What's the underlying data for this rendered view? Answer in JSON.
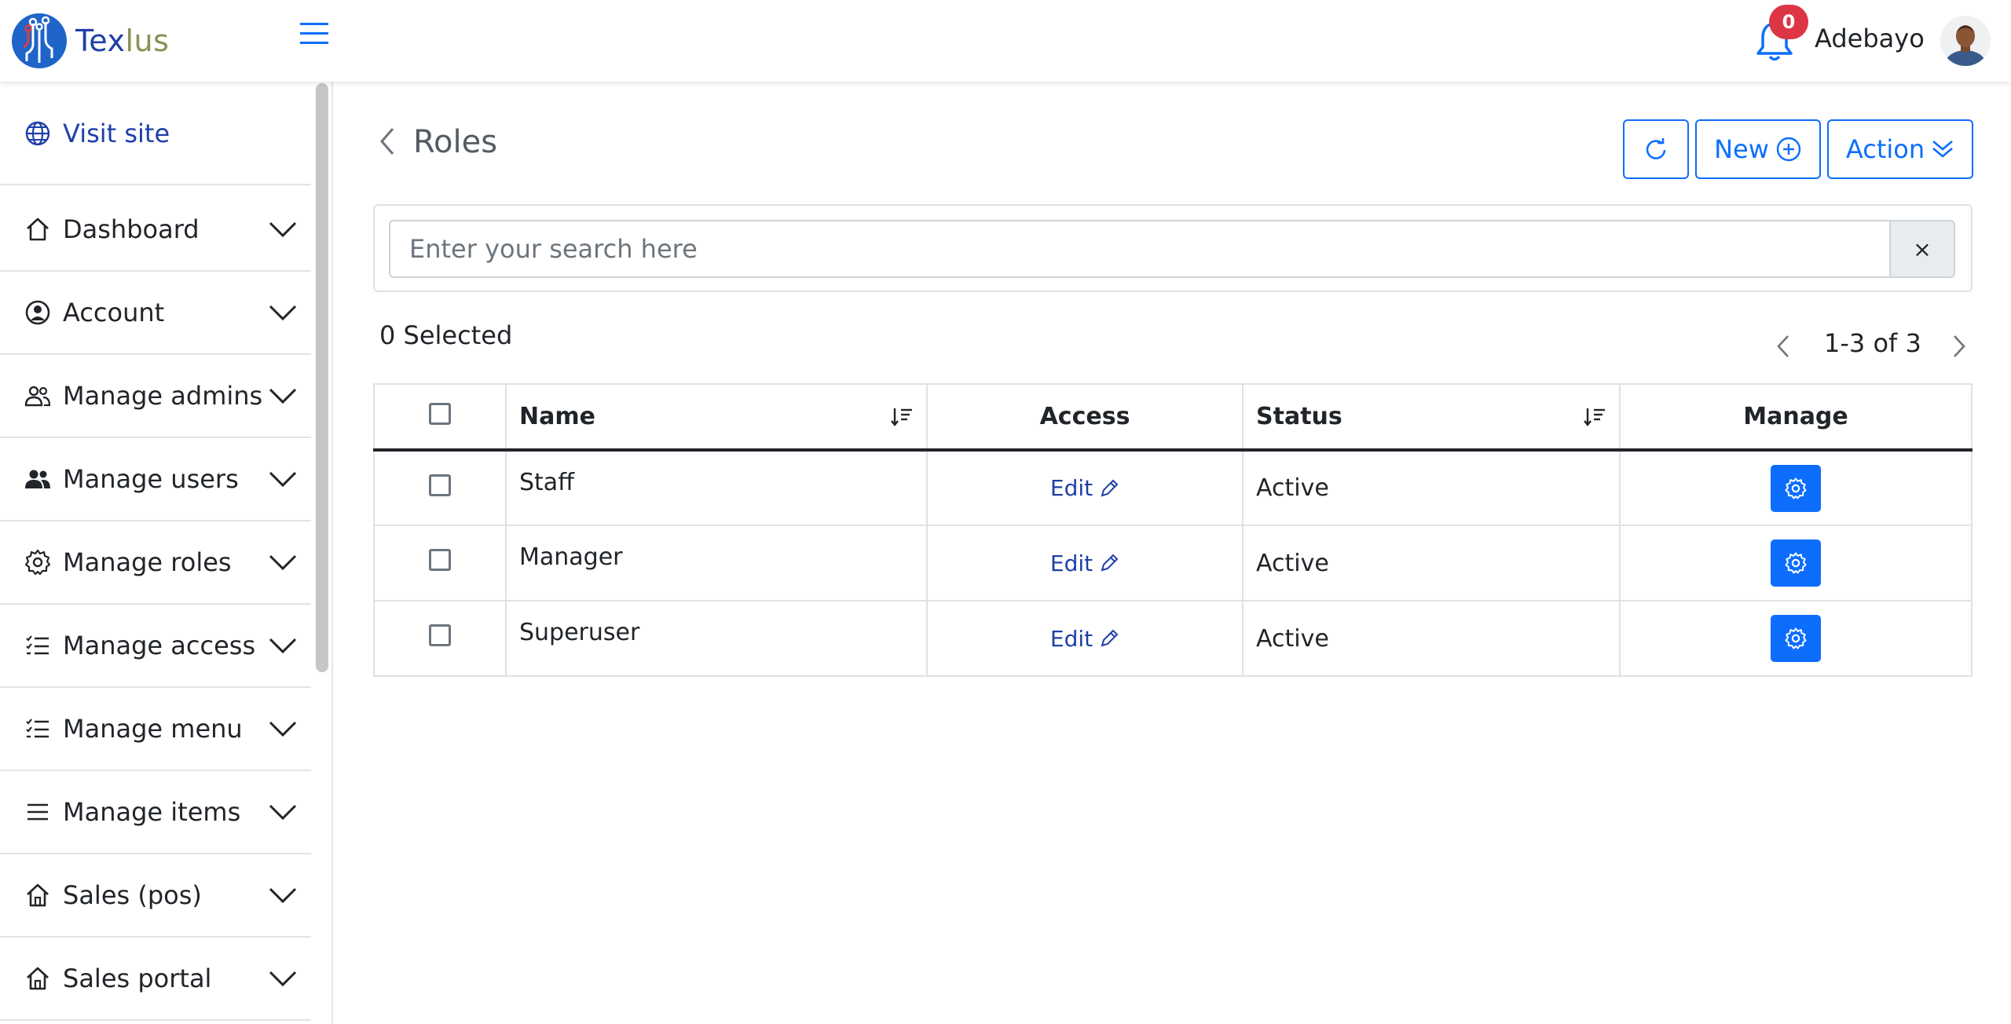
{
  "header": {
    "logo_part1": "Tex",
    "logo_part2": "lus",
    "notifications_count": "0",
    "username": "Adebayo"
  },
  "sidebar": {
    "items": [
      {
        "label": "Visit site",
        "icon": "globe-icon"
      },
      {
        "label": "Dashboard",
        "icon": "house-icon"
      },
      {
        "label": "Account",
        "icon": "user-circle-icon"
      },
      {
        "label": "Manage admins",
        "icon": "people-outline-icon"
      },
      {
        "label": "Manage users",
        "icon": "people-fill-icon"
      },
      {
        "label": "Manage roles",
        "icon": "gear-icon"
      },
      {
        "label": "Manage access",
        "icon": "list-check-icon"
      },
      {
        "label": "Manage menu",
        "icon": "list-check-icon"
      },
      {
        "label": "Manage items",
        "icon": "list-icon"
      },
      {
        "label": "Sales (pos)",
        "icon": "shop-icon"
      },
      {
        "label": "Sales portal",
        "icon": "shop-icon"
      }
    ]
  },
  "page": {
    "title": "Roles",
    "new_label": "New",
    "action_label": "Action",
    "search_placeholder": "Enter your search here",
    "clear_label": "×",
    "selected_text": "0 Selected",
    "pagination": "1-3 of 3"
  },
  "table": {
    "headers": {
      "name": "Name",
      "access": "Access",
      "status": "Status",
      "manage": "Manage"
    },
    "rows": [
      {
        "name": "Staff",
        "access": "Edit",
        "status": "Active"
      },
      {
        "name": "Manager",
        "access": "Edit",
        "status": "Active"
      },
      {
        "name": "Superuser",
        "access": "Edit",
        "status": "Active"
      }
    ]
  },
  "colors": {
    "primary": "#0d6efd",
    "link": "#1f3fa8",
    "badge": "#dc3545"
  }
}
